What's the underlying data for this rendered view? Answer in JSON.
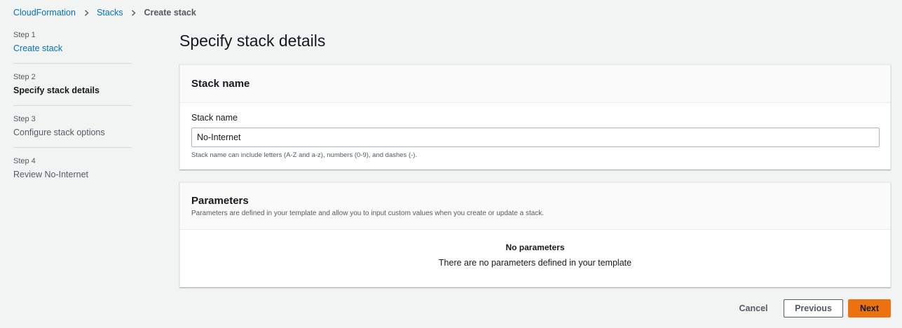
{
  "breadcrumb": {
    "items": [
      "CloudFormation",
      "Stacks"
    ],
    "current": "Create stack"
  },
  "steps": [
    {
      "number": "Step 1",
      "title": "Create stack"
    },
    {
      "number": "Step 2",
      "title": "Specify stack details"
    },
    {
      "number": "Step 3",
      "title": "Configure stack options"
    },
    {
      "number": "Step 4",
      "title": "Review No-Internet"
    }
  ],
  "page_title": "Specify stack details",
  "stack_name_panel": {
    "title": "Stack name",
    "field_label": "Stack name",
    "field_value": "No-Internet",
    "hint": "Stack name can include letters (A-Z and a-z), numbers (0-9), and dashes (-)."
  },
  "parameters_panel": {
    "title": "Parameters",
    "description": "Parameters are defined in your template and allow you to input custom values when you create or update a stack.",
    "empty_title": "No parameters",
    "empty_description": "There are no parameters defined in your template"
  },
  "footer": {
    "cancel_label": "Cancel",
    "previous_label": "Previous",
    "next_label": "Next"
  },
  "colors": {
    "link": "#0073bb",
    "primary_button": "#ec7211",
    "background": "#f2f3f3"
  },
  "icons": {
    "breadcrumb_separator": "chevron-right-icon"
  }
}
